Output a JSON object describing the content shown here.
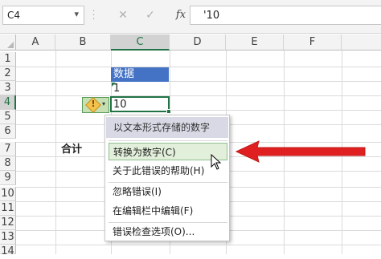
{
  "formula_bar": {
    "name_box": "C4",
    "name_box_arrow": "▾",
    "cancel_glyph": "✕",
    "confirm_glyph": "✓",
    "fx_label": "fx",
    "formula_value": "'10"
  },
  "columns": [
    "A",
    "B",
    "C",
    "D",
    "E",
    "F"
  ],
  "rows": [
    "1",
    "2",
    "3",
    "4",
    "5",
    "6",
    "7",
    "8",
    "9",
    "10",
    "11",
    "12",
    "13",
    "14"
  ],
  "cells": {
    "C2": "数据",
    "C3": "1",
    "C4": "10",
    "B7": "合计"
  },
  "error_button": {
    "icon": "warning-diamond-icon",
    "exclamation": "!",
    "dropdown_glyph": "▾"
  },
  "context_menu": {
    "title": "以文本形式存储的数字",
    "items": [
      "转换为数字(C)",
      "关于此错误的帮助(H)",
      "忽略错误(I)",
      "在编辑栏中编辑(F)",
      "错误检查选项(O)..."
    ]
  },
  "colors": {
    "accent_green": "#217346",
    "header_fill_blue": "#4472c4",
    "arrow_red": "#e02020",
    "highlight_green": "#e2efda"
  }
}
